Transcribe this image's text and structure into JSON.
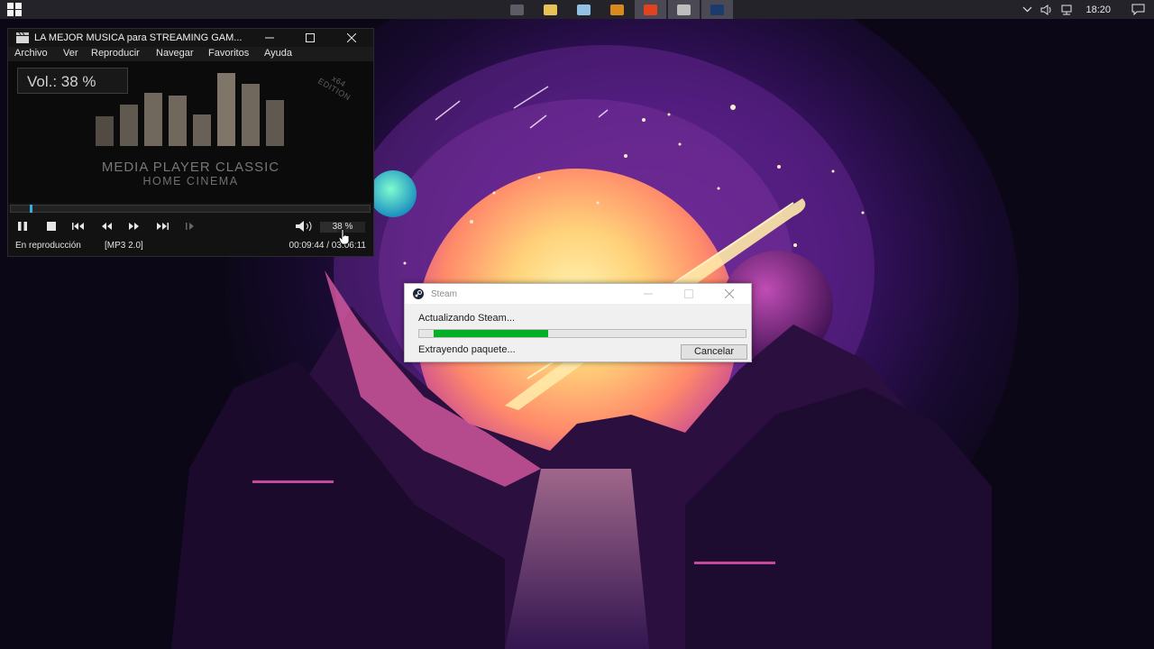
{
  "taskbar": {
    "apps": [
      {
        "name": "app-1",
        "color": "#5c5c66"
      },
      {
        "name": "file-explorer",
        "color": "#e8c257"
      },
      {
        "name": "notepad",
        "color": "#93c1e3"
      },
      {
        "name": "app-4",
        "color": "#d88a1e"
      },
      {
        "name": "brave-browser",
        "color": "#e2431e"
      },
      {
        "name": "media-player-classic",
        "color": "#bdbdbd"
      },
      {
        "name": "steam",
        "color": "#1b3b6f"
      }
    ],
    "clock": "18:20"
  },
  "mpc": {
    "title": "LA MEJOR MUSICA para STREAMING GAM...",
    "menu": [
      "Archivo",
      "Ver",
      "Reproducir",
      "Navegar",
      "Favoritos",
      "Ayuda"
    ],
    "volume_osd": "Vol.: 38 %",
    "edition": [
      "x64",
      "EDITION"
    ],
    "brand_line1": "MEDIA PLAYER CLASSIC",
    "brand_line2": "HOME CINEMA",
    "volume_text": "38 %",
    "volume_level": 0.38,
    "seek_position": 0.053,
    "status": "En reproducción",
    "format": "[MP3 2.0]",
    "time": "00:09:44 / 03:06:11",
    "accent_color": "#37aee0"
  },
  "steam": {
    "title": "Steam",
    "status": "Actualizando Steam...",
    "progress": 0.35,
    "substatus": "Extrayendo paquete...",
    "cancel_label": "Cancelar",
    "progress_color": "#06b025"
  }
}
